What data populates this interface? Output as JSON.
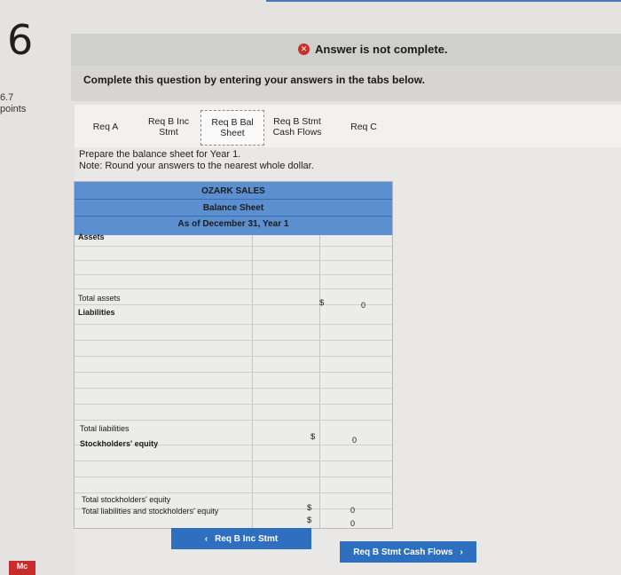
{
  "question_number": "6",
  "points": {
    "value": "6.7",
    "label": "points"
  },
  "status": {
    "icon": "x-circle-icon",
    "text": "Answer is not complete.",
    "color": "#c9302c"
  },
  "instructions": "Complete this question by entering your answers in the tabs below.",
  "tabs": [
    {
      "label": "Req A",
      "active": false
    },
    {
      "label": "Req B Inc Stmt",
      "active": false
    },
    {
      "label": "Req B Bal Sheet",
      "active": true
    },
    {
      "label": "Req B Stmt Cash Flows",
      "active": false
    },
    {
      "label": "Req C",
      "active": false
    }
  ],
  "prompt": {
    "line1": "Prepare the balance sheet for Year 1.",
    "line2": "Note: Round your answers to the nearest whole dollar."
  },
  "balance_sheet": {
    "company": "OZARK SALES",
    "title": "Balance Sheet",
    "date": "As of December 31, Year 1",
    "assets_label": "Assets",
    "total_assets_label": "Total assets",
    "total_assets_currency": "$",
    "total_assets_value": "0",
    "liabilities_label": "Liabilities",
    "total_liabilities_label": "Total liabilities",
    "total_liabilities_currency": "$",
    "total_liabilities_value": "0",
    "equity_label": "Stockholders' equity",
    "total_equity_label": "Total stockholders' equity",
    "total_equity_currency": "$",
    "total_equity_value": "0",
    "total_le_label": "Total liabilities and stockholders' equity",
    "total_le_currency": "$",
    "total_le_value": "0"
  },
  "navigation": {
    "prev_label": "Req B Inc Stmt",
    "prev_icon": "chevron-left-icon",
    "next_label": "Req B Stmt Cash Flows",
    "next_icon": "chevron-right-icon"
  },
  "brand": {
    "logo_text": "Mc",
    "logo_color": "#c92a2a",
    "accent": "#2f6fbf"
  }
}
